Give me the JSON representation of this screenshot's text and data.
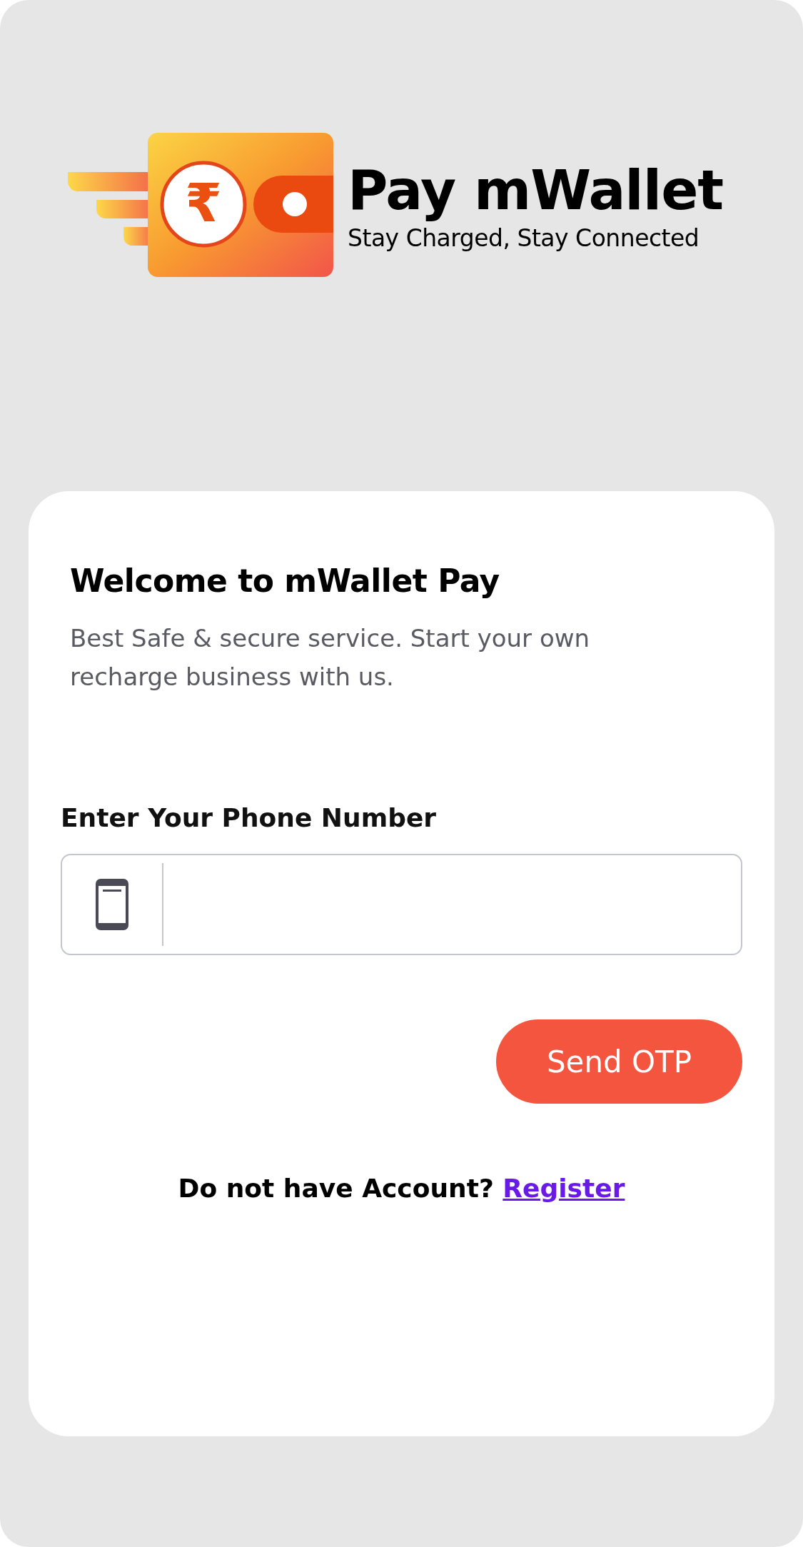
{
  "logo": {
    "symbol": "₹",
    "title": "Pay mWallet",
    "tagline": "Stay Charged, Stay Connected"
  },
  "card": {
    "heading": "Welcome to mWallet Pay",
    "description": "Best Safe & secure service. Start your own recharge business with us.",
    "phone_label": "Enter Your Phone Number",
    "send_button": "Send OTP",
    "register_prompt": "Do not have Account?",
    "register_link": "Register"
  }
}
